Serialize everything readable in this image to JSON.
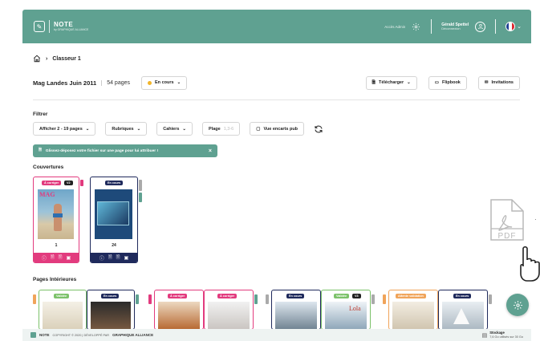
{
  "topbar": {
    "logo_text": "NOTE",
    "logo_sub": "by GRAPHIQUE ALLIANCE",
    "acces_admin": "Accès Admin",
    "user_name": "Gérald Spettel",
    "logout": "Déconnexion"
  },
  "breadcrumb": {
    "label": "Classeur 1"
  },
  "magazine": {
    "title": "Mag Landes Juin 2011",
    "pages": "54 pages",
    "status": "En cours",
    "status_color": "#f2b52a"
  },
  "actions": {
    "download": "Télécharger",
    "flipbook": "Flipbook",
    "invitations": "Invitations"
  },
  "filters": {
    "heading": "Filtrer",
    "display": "Afficher 2 - 19 pages",
    "rubriques": "Rubriques",
    "cahiers": "Cahiers",
    "plage": "Plage",
    "plage_placeholder": "1,3-6",
    "inserts": "Vue encarts pub"
  },
  "hint": "Glissez-déposez votre fichier sur une page pour lui attribuer !",
  "sections": {
    "covers": "Couvertures",
    "inner": "Pages Intérieures"
  },
  "covers": [
    {
      "badge": "À corriger",
      "version": "V2",
      "number": "1",
      "color": "#e23b7e"
    },
    {
      "badge": "En cours",
      "number": "24",
      "color": "#1f2a5c"
    }
  ],
  "inner_badges": [
    "Validée",
    "En cours",
    "À corriger",
    "À corriger",
    "En cours",
    "Validée",
    "V3",
    "Attente validation",
    "En cours"
  ],
  "footer": {
    "brand": "NOTE",
    "copyright": "COPYRIGHT © 2020 | DÉVELOPPÉ PAR",
    "company": "GRAPHIQUE ALLIANCE",
    "storage_label": "Stockage",
    "storage_value": "7,6 Go utilisés sur 30 Go"
  },
  "colors": {
    "accent": "#5fa191",
    "pink": "#e23b7e",
    "navy": "#1f2a5c",
    "green": "#7cc26a",
    "orange": "#f0a45a"
  }
}
